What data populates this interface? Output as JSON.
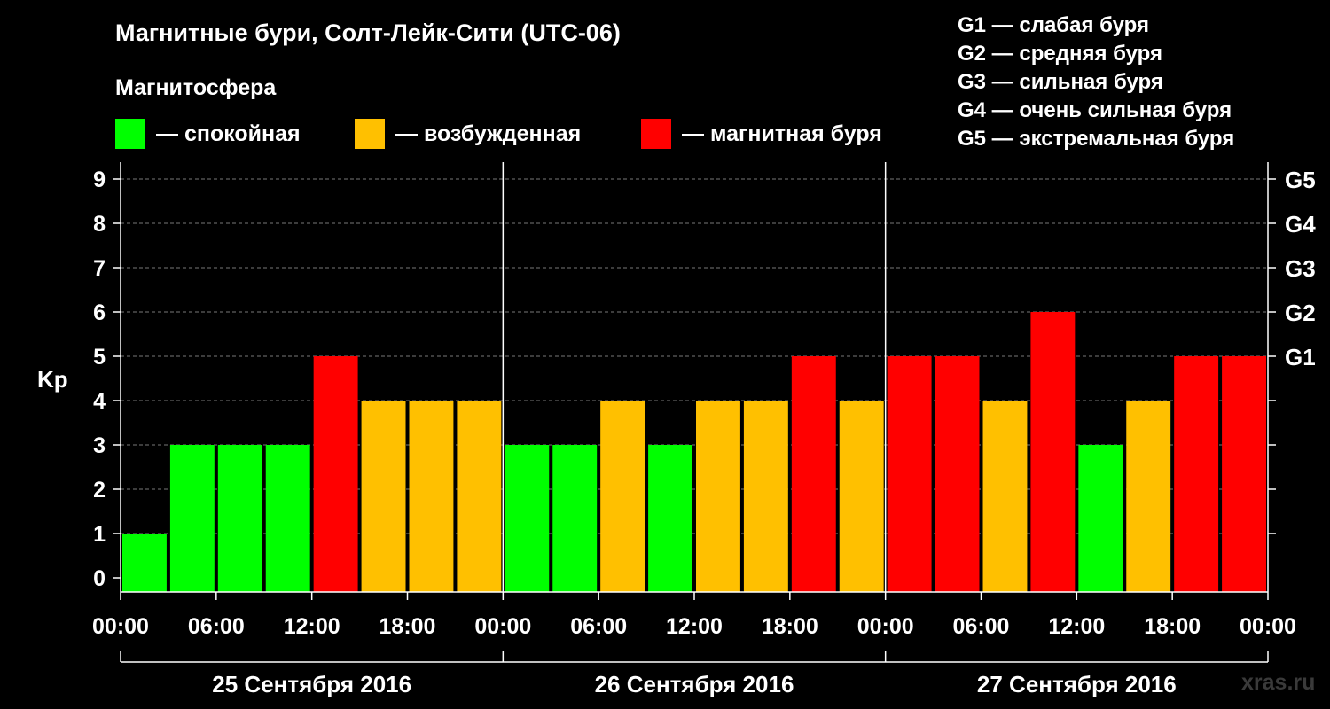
{
  "header": {
    "title": "Магнитные бури, Солт-Лейк-Сити (UTC-06)",
    "subtitle": "Магнитосфера"
  },
  "legend": [
    {
      "label": "— спокойная",
      "color": "#00ff00"
    },
    {
      "label": "— возбужденная",
      "color": "#ffc000"
    },
    {
      "label": "— магнитная буря",
      "color": "#ff0000"
    }
  ],
  "g_levels": [
    "G1 — слабая буря",
    "G2 — средняя буря",
    "G3 — сильная буря",
    "G4 — очень сильная буря",
    "G5 — экстремальная буря"
  ],
  "watermark": "xras.ru",
  "chart_data": {
    "type": "bar",
    "ylabel": "Kp",
    "ylim": [
      0,
      9
    ],
    "yticks": [
      0,
      1,
      2,
      3,
      4,
      5,
      6,
      7,
      8,
      9
    ],
    "right_ticks": [
      {
        "value": 5,
        "label": "G1"
      },
      {
        "value": 6,
        "label": "G2"
      },
      {
        "value": 7,
        "label": "G3"
      },
      {
        "value": 8,
        "label": "G4"
      },
      {
        "value": 9,
        "label": "G5"
      }
    ],
    "x_tick_labels": [
      "00:00",
      "06:00",
      "12:00",
      "18:00",
      "00:00",
      "06:00",
      "12:00",
      "18:00",
      "00:00",
      "06:00",
      "12:00",
      "18:00",
      "00:00"
    ],
    "days": [
      "25 Сентября 2016",
      "26 Сентября 2016",
      "27 Сентября 2016"
    ],
    "interval_hours": 3,
    "values": [
      1,
      3,
      3,
      3,
      5,
      4,
      4,
      4,
      3,
      3,
      4,
      3,
      4,
      4,
      5,
      4,
      5,
      5,
      4,
      6,
      3,
      4,
      5,
      5
    ],
    "colors": {
      "calm": "#00ff00",
      "excited": "#ffc000",
      "storm": "#ff0000"
    },
    "grid": "dashed horizontal"
  }
}
